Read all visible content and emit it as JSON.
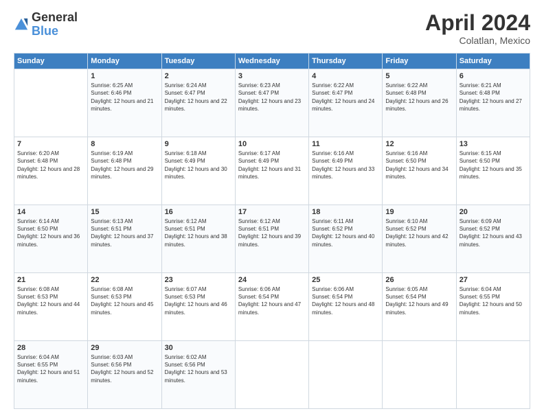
{
  "header": {
    "logo_general": "General",
    "logo_blue": "Blue",
    "month_title": "April 2024",
    "location": "Colatlan, Mexico"
  },
  "weekdays": [
    "Sunday",
    "Monday",
    "Tuesday",
    "Wednesday",
    "Thursday",
    "Friday",
    "Saturday"
  ],
  "weeks": [
    [
      {
        "day": "",
        "sunrise": "",
        "sunset": "",
        "daylight": ""
      },
      {
        "day": "1",
        "sunrise": "Sunrise: 6:25 AM",
        "sunset": "Sunset: 6:46 PM",
        "daylight": "Daylight: 12 hours and 21 minutes."
      },
      {
        "day": "2",
        "sunrise": "Sunrise: 6:24 AM",
        "sunset": "Sunset: 6:47 PM",
        "daylight": "Daylight: 12 hours and 22 minutes."
      },
      {
        "day": "3",
        "sunrise": "Sunrise: 6:23 AM",
        "sunset": "Sunset: 6:47 PM",
        "daylight": "Daylight: 12 hours and 23 minutes."
      },
      {
        "day": "4",
        "sunrise": "Sunrise: 6:22 AM",
        "sunset": "Sunset: 6:47 PM",
        "daylight": "Daylight: 12 hours and 24 minutes."
      },
      {
        "day": "5",
        "sunrise": "Sunrise: 6:22 AM",
        "sunset": "Sunset: 6:48 PM",
        "daylight": "Daylight: 12 hours and 26 minutes."
      },
      {
        "day": "6",
        "sunrise": "Sunrise: 6:21 AM",
        "sunset": "Sunset: 6:48 PM",
        "daylight": "Daylight: 12 hours and 27 minutes."
      }
    ],
    [
      {
        "day": "7",
        "sunrise": "Sunrise: 6:20 AM",
        "sunset": "Sunset: 6:48 PM",
        "daylight": "Daylight: 12 hours and 28 minutes."
      },
      {
        "day": "8",
        "sunrise": "Sunrise: 6:19 AM",
        "sunset": "Sunset: 6:48 PM",
        "daylight": "Daylight: 12 hours and 29 minutes."
      },
      {
        "day": "9",
        "sunrise": "Sunrise: 6:18 AM",
        "sunset": "Sunset: 6:49 PM",
        "daylight": "Daylight: 12 hours and 30 minutes."
      },
      {
        "day": "10",
        "sunrise": "Sunrise: 6:17 AM",
        "sunset": "Sunset: 6:49 PM",
        "daylight": "Daylight: 12 hours and 31 minutes."
      },
      {
        "day": "11",
        "sunrise": "Sunrise: 6:16 AM",
        "sunset": "Sunset: 6:49 PM",
        "daylight": "Daylight: 12 hours and 33 minutes."
      },
      {
        "day": "12",
        "sunrise": "Sunrise: 6:16 AM",
        "sunset": "Sunset: 6:50 PM",
        "daylight": "Daylight: 12 hours and 34 minutes."
      },
      {
        "day": "13",
        "sunrise": "Sunrise: 6:15 AM",
        "sunset": "Sunset: 6:50 PM",
        "daylight": "Daylight: 12 hours and 35 minutes."
      }
    ],
    [
      {
        "day": "14",
        "sunrise": "Sunrise: 6:14 AM",
        "sunset": "Sunset: 6:50 PM",
        "daylight": "Daylight: 12 hours and 36 minutes."
      },
      {
        "day": "15",
        "sunrise": "Sunrise: 6:13 AM",
        "sunset": "Sunset: 6:51 PM",
        "daylight": "Daylight: 12 hours and 37 minutes."
      },
      {
        "day": "16",
        "sunrise": "Sunrise: 6:12 AM",
        "sunset": "Sunset: 6:51 PM",
        "daylight": "Daylight: 12 hours and 38 minutes."
      },
      {
        "day": "17",
        "sunrise": "Sunrise: 6:12 AM",
        "sunset": "Sunset: 6:51 PM",
        "daylight": "Daylight: 12 hours and 39 minutes."
      },
      {
        "day": "18",
        "sunrise": "Sunrise: 6:11 AM",
        "sunset": "Sunset: 6:52 PM",
        "daylight": "Daylight: 12 hours and 40 minutes."
      },
      {
        "day": "19",
        "sunrise": "Sunrise: 6:10 AM",
        "sunset": "Sunset: 6:52 PM",
        "daylight": "Daylight: 12 hours and 42 minutes."
      },
      {
        "day": "20",
        "sunrise": "Sunrise: 6:09 AM",
        "sunset": "Sunset: 6:52 PM",
        "daylight": "Daylight: 12 hours and 43 minutes."
      }
    ],
    [
      {
        "day": "21",
        "sunrise": "Sunrise: 6:08 AM",
        "sunset": "Sunset: 6:53 PM",
        "daylight": "Daylight: 12 hours and 44 minutes."
      },
      {
        "day": "22",
        "sunrise": "Sunrise: 6:08 AM",
        "sunset": "Sunset: 6:53 PM",
        "daylight": "Daylight: 12 hours and 45 minutes."
      },
      {
        "day": "23",
        "sunrise": "Sunrise: 6:07 AM",
        "sunset": "Sunset: 6:53 PM",
        "daylight": "Daylight: 12 hours and 46 minutes."
      },
      {
        "day": "24",
        "sunrise": "Sunrise: 6:06 AM",
        "sunset": "Sunset: 6:54 PM",
        "daylight": "Daylight: 12 hours and 47 minutes."
      },
      {
        "day": "25",
        "sunrise": "Sunrise: 6:06 AM",
        "sunset": "Sunset: 6:54 PM",
        "daylight": "Daylight: 12 hours and 48 minutes."
      },
      {
        "day": "26",
        "sunrise": "Sunrise: 6:05 AM",
        "sunset": "Sunset: 6:54 PM",
        "daylight": "Daylight: 12 hours and 49 minutes."
      },
      {
        "day": "27",
        "sunrise": "Sunrise: 6:04 AM",
        "sunset": "Sunset: 6:55 PM",
        "daylight": "Daylight: 12 hours and 50 minutes."
      }
    ],
    [
      {
        "day": "28",
        "sunrise": "Sunrise: 6:04 AM",
        "sunset": "Sunset: 6:55 PM",
        "daylight": "Daylight: 12 hours and 51 minutes."
      },
      {
        "day": "29",
        "sunrise": "Sunrise: 6:03 AM",
        "sunset": "Sunset: 6:56 PM",
        "daylight": "Daylight: 12 hours and 52 minutes."
      },
      {
        "day": "30",
        "sunrise": "Sunrise: 6:02 AM",
        "sunset": "Sunset: 6:56 PM",
        "daylight": "Daylight: 12 hours and 53 minutes."
      },
      {
        "day": "",
        "sunrise": "",
        "sunset": "",
        "daylight": ""
      },
      {
        "day": "",
        "sunrise": "",
        "sunset": "",
        "daylight": ""
      },
      {
        "day": "",
        "sunrise": "",
        "sunset": "",
        "daylight": ""
      },
      {
        "day": "",
        "sunrise": "",
        "sunset": "",
        "daylight": ""
      }
    ]
  ]
}
